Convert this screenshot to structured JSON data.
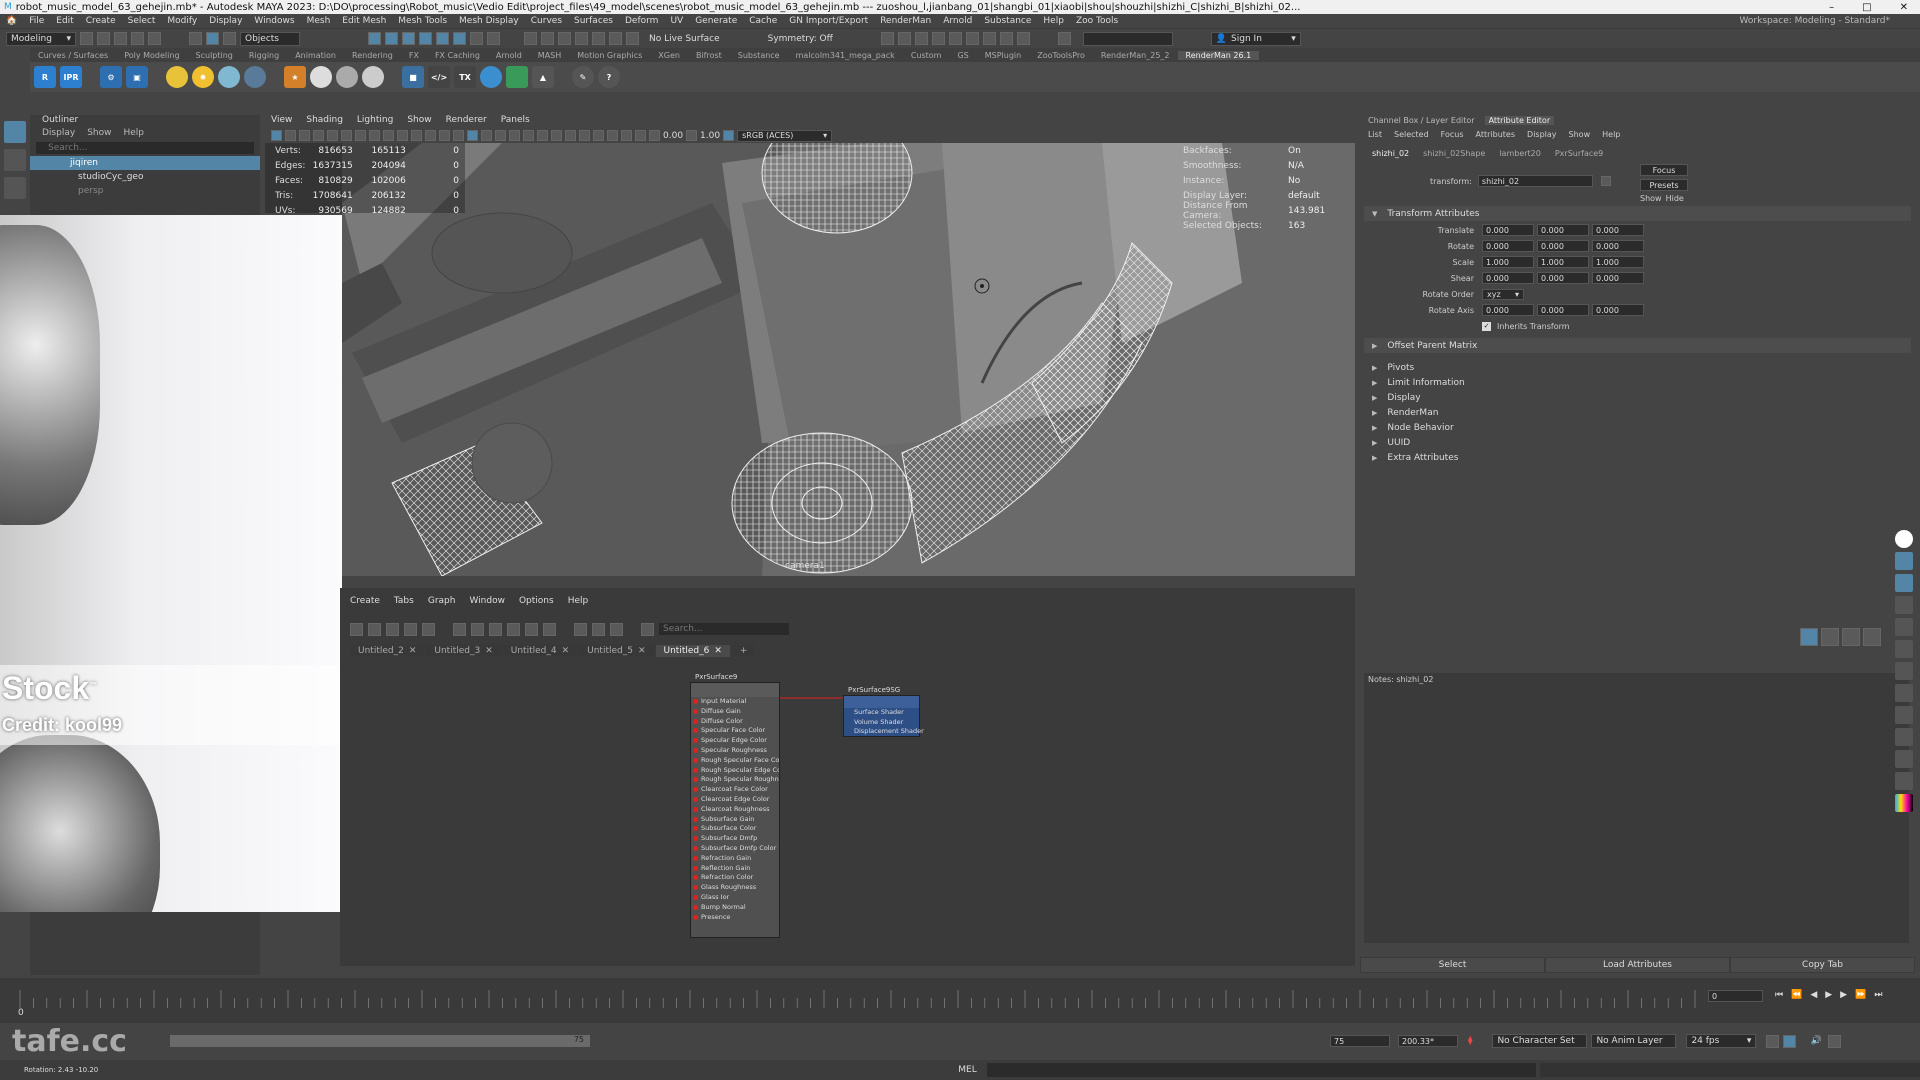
{
  "titlebar": {
    "title": "robot_music_model_63_gehejin.mb* - Autodesk MAYA 2023: D:\\DO\\processing\\Robot_music\\Vedio Edit\\project_files\\49_model\\scenes\\robot_music_model_63_gehejin.mb  ---  zuoshou_l,jianbang_01|shangbi_01|xiaobi|shou|shouzhi|shizhi_C|shizhi_B|shizhi_02...",
    "min": "–",
    "max": "□",
    "close": "✕"
  },
  "menu": [
    "File",
    "Edit",
    "Create",
    "Select",
    "Modify",
    "Display",
    "Windows",
    "Mesh",
    "Edit Mesh",
    "Mesh Tools",
    "Mesh Display",
    "Curves",
    "Surfaces",
    "Deform",
    "UV",
    "Generate",
    "Cache",
    "GN Import/Export",
    "RenderMan",
    "Arnold",
    "Substance",
    "Help",
    "Zoo Tools"
  ],
  "workspace": "Workspace: Modeling - Standard*",
  "statusline": {
    "mode": "Modeling",
    "objects": "Objects",
    "live_surface": "No Live Surface",
    "symmetry": "Symmetry: Off",
    "sign_in": "Sign In"
  },
  "shelf_tabs": [
    "Curves / Surfaces",
    "Poly Modeling",
    "Sculpting",
    "Rigging",
    "Animation",
    "Rendering",
    "FX",
    "FX Caching",
    "Arnold",
    "MASH",
    "Motion Graphics",
    "XGen",
    "Bifrost",
    "Substance",
    "malcolm341_mega_pack",
    "Custom",
    "GS",
    "MSPlugin",
    "ZooToolsPro",
    "RenderMan_25_2",
    "RenderMan 26.1"
  ],
  "shelf_active": "RenderMan 26.1",
  "shelf_labels": {
    "r": "R",
    "ipr": "IPR",
    "tx": "TX"
  },
  "outliner": {
    "title": "Outliner",
    "menu": [
      "Display",
      "Show",
      "Help"
    ],
    "search": "Search...",
    "items": [
      "jiqiren",
      "studioCyc_geo",
      "persp"
    ]
  },
  "video_overlay": {
    "stock": "Stock",
    "tm": "™",
    "credit": "Credit: kool99"
  },
  "viewport": {
    "menu": [
      "View",
      "Shading",
      "Lighting",
      "Show",
      "Renderer",
      "Panels"
    ],
    "exposure": "0.00",
    "gamma": "1.00",
    "colorspace": "sRGB (ACES)",
    "camera": "camera1",
    "hud_left": [
      {
        "k": "Verts:",
        "v": "816653",
        "v2": "165113",
        "v3": "0"
      },
      {
        "k": "Edges:",
        "v": "1637315",
        "v2": "204094",
        "v3": "0"
      },
      {
        "k": "Faces:",
        "v": "810829",
        "v2": "102006",
        "v3": "0"
      },
      {
        "k": "Tris:",
        "v": "1708641",
        "v2": "206132",
        "v3": "0"
      },
      {
        "k": "UVs:",
        "v": "930569",
        "v2": "124882",
        "v3": "0"
      }
    ],
    "hud_right": [
      {
        "k": "Backfaces:",
        "v": "On"
      },
      {
        "k": "Smoothness:",
        "v": "N/A"
      },
      {
        "k": "Instance:",
        "v": "No"
      },
      {
        "k": "Display Layer:",
        "v": "default"
      },
      {
        "k": "Distance From Camera:",
        "v": "143.981"
      },
      {
        "k": "Selected Objects:",
        "v": "163"
      }
    ]
  },
  "node_editor": {
    "menu": [
      "Create",
      "Tabs",
      "Graph",
      "Window",
      "Options",
      "Help"
    ],
    "search": "Search...",
    "tabs": [
      "Untitled_2",
      "Untitled_3",
      "Untitled_4",
      "Untitled_5",
      "Untitled_6"
    ],
    "active_tab": "Untitled_6",
    "tab_close": "✕",
    "add_tab": "+",
    "node1": {
      "title": "PxrSurface9",
      "attrs": [
        "Input Material",
        "Diffuse Gain",
        "Diffuse Color",
        "Specular Face Color",
        "Specular Edge Color",
        "Specular Roughness",
        "Rough Specular Face Color",
        "Rough Specular Edge Color",
        "Rough Specular Roughness",
        "Clearcoat Face Color",
        "Clearcoat Edge Color",
        "Clearcoat Roughness",
        "Subsurface Gain",
        "Subsurface Color",
        "Subsurface Dmfp",
        "Subsurface Dmfp Color",
        "Refraction Gain",
        "Reflection Gain",
        "Refraction Color",
        "Glass Roughness",
        "Glass Ior",
        "Bump Normal",
        "Presence"
      ]
    },
    "node2": {
      "title": "PxrSurface9SG",
      "attrs": [
        "Surface Shader",
        "Volume Shader",
        "Displacement Shader"
      ]
    }
  },
  "attribute_editor": {
    "tabs": [
      "Channel Box / Layer Editor",
      "Attribute Editor"
    ],
    "active_tab": "Attribute Editor",
    "menu": [
      "List",
      "Selected",
      "Focus",
      "Attributes",
      "Display",
      "Show",
      "Help"
    ],
    "node_tabs": [
      "shizhi_02",
      "shizhi_02Shape",
      "lambert20",
      "PxrSurface9"
    ],
    "active_node_tab": "shizhi_02",
    "transform_label": "transform:",
    "transform_value": "shizhi_02",
    "buttons": {
      "focus": "Focus",
      "presets": "Presets",
      "show": "Show",
      "hide": "Hide"
    },
    "transform_section": "Transform Attributes",
    "rows": [
      {
        "label": "Translate",
        "x": "0.000",
        "y": "0.000",
        "z": "0.000"
      },
      {
        "label": "Rotate",
        "x": "0.000",
        "y": "0.000",
        "z": "0.000"
      },
      {
        "label": "Scale",
        "x": "1.000",
        "y": "1.000",
        "z": "1.000"
      },
      {
        "label": "Shear",
        "x": "0.000",
        "y": "0.000",
        "z": "0.000"
      }
    ],
    "rotate_order_label": "Rotate Order",
    "rotate_order": "xyz",
    "rotate_axis": {
      "label": "Rotate Axis",
      "x": "0.000",
      "y": "0.000",
      "z": "0.000"
    },
    "inherits": "Inherits Transform",
    "offset_parent": "Offset Parent Matrix",
    "sections": [
      "Pivots",
      "Limit Information",
      "Display",
      "RenderMan",
      "Node Behavior",
      "UUID",
      "Extra Attributes"
    ],
    "notes": "Notes: shizhi_02",
    "bottom": [
      "Select",
      "Load Attributes",
      "Copy Tab"
    ]
  },
  "timeline": {
    "current": "0",
    "fps": "24 fps",
    "start": "0",
    "range_end": "75",
    "end": "75",
    "end2": "200.33*",
    "character": "No Character Set",
    "anim_layer": "No Anim Layer"
  },
  "cmdline": {
    "mel": "MEL",
    "rotation": "Rotation:  2.43    -10.20"
  },
  "watermark": "tafe.cc",
  "colors": {
    "accent": "#5285a6",
    "node_blue": "#2e4f86",
    "port_red": "#dd2222"
  }
}
